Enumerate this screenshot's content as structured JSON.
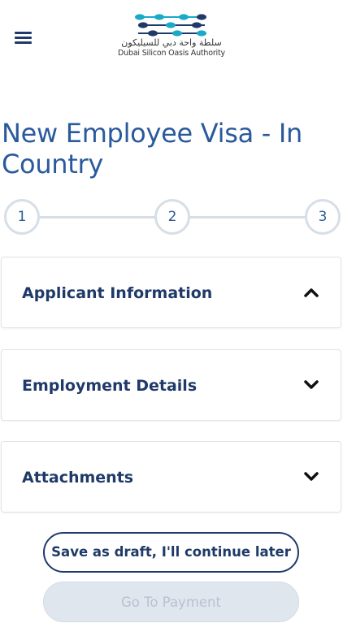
{
  "header": {
    "menu_icon": "hamburger-menu-icon",
    "logo": {
      "arabic_text": "سلطة واحة دبي للسيليكون",
      "english_text": "Dubai Silicon Oasis Authority",
      "colors": [
        "#1aa9c9",
        "#1f3a68"
      ]
    }
  },
  "page": {
    "title": "New Employee Visa - In Country"
  },
  "stepper": {
    "steps": [
      "1",
      "2",
      "3"
    ]
  },
  "sections": [
    {
      "label": "Applicant Information",
      "state": "expanded",
      "icon": "chevron-up-icon"
    },
    {
      "label": "Employment Details",
      "state": "collapsed",
      "icon": "chevron-down-icon"
    },
    {
      "label": "Attachments",
      "state": "collapsed",
      "icon": "chevron-down-icon"
    }
  ],
  "actions": {
    "draft_label": "Save as draft, I'll continue later",
    "payment_label": "Go To Payment",
    "payment_enabled": false
  },
  "colors": {
    "primary": "#1f3a68",
    "title": "#2a5a9c",
    "step_border": "#d6dee8",
    "disabled_button": "#dfe6ee"
  }
}
